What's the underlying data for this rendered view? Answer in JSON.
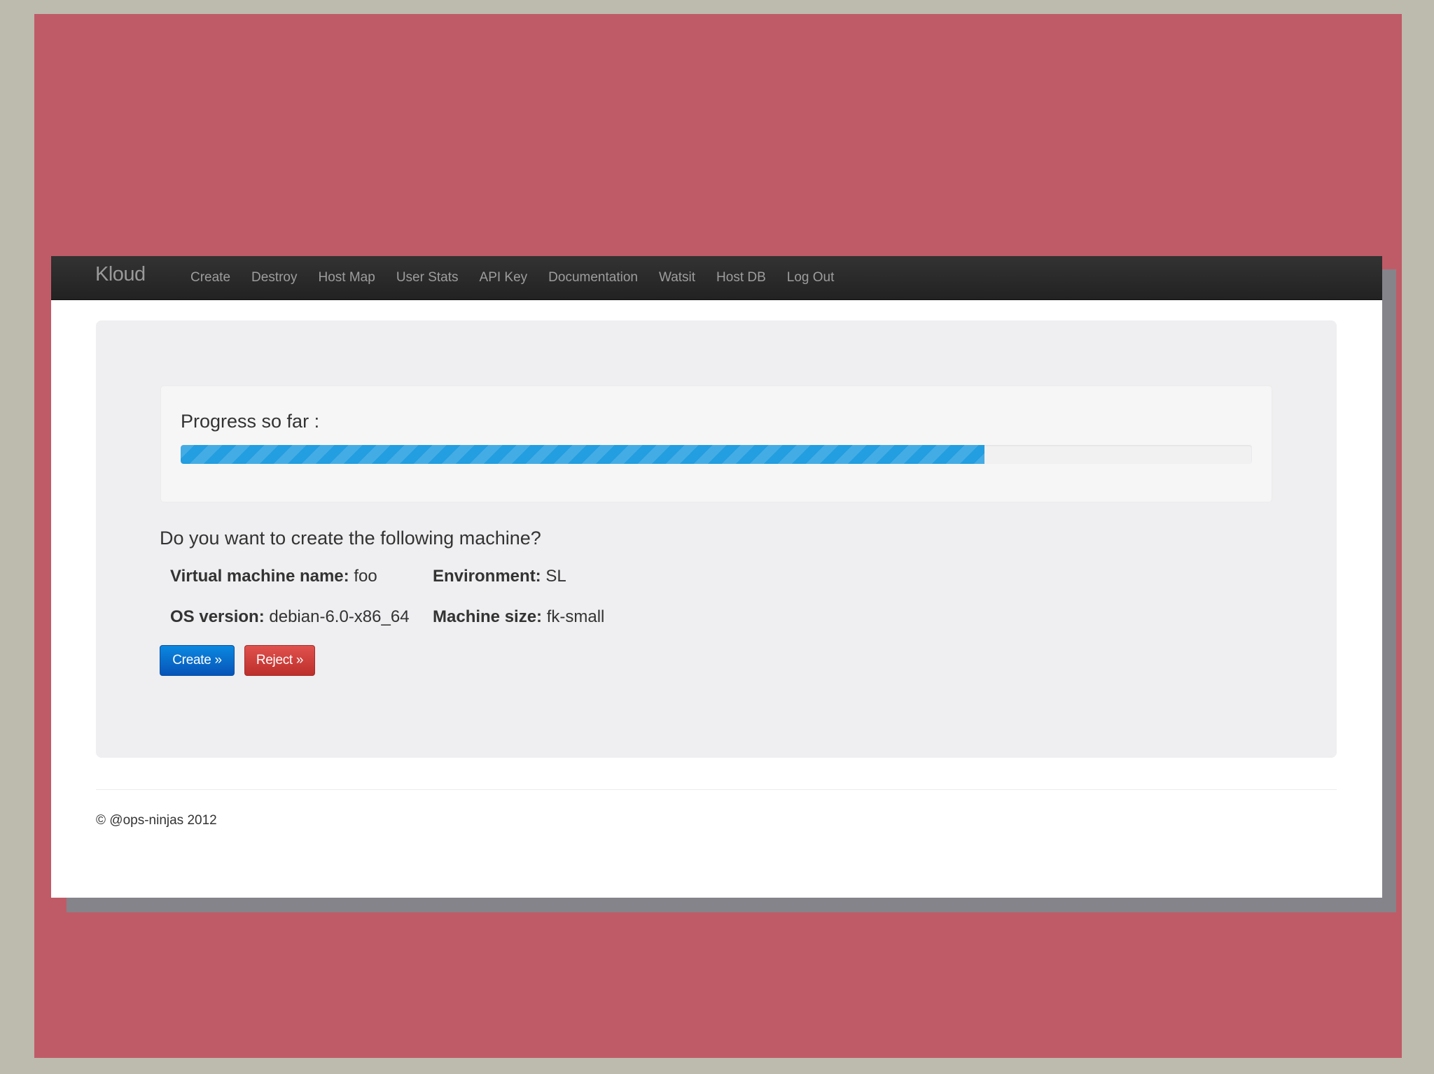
{
  "navbar": {
    "brand": "Kloud",
    "links": [
      "Create",
      "Destroy",
      "Host Map",
      "User Stats",
      "API Key",
      "Documentation",
      "Watsit",
      "Host DB",
      "Log Out"
    ]
  },
  "progress": {
    "label": "Progress so far :",
    "percent": 75
  },
  "confirm": {
    "question": "Do you want to create the following machine?",
    "details": {
      "vm_name_label": "Virtual machine name:",
      "vm_name_value": " foo",
      "environment_label": "Environment:",
      "environment_value": " SL",
      "os_version_label": "OS version:",
      "os_version_value": " debian-6.0-x86_64",
      "machine_size_label": "Machine size:",
      "machine_size_value": " fk-small"
    },
    "create_button": "Create »",
    "reject_button": "Reject »"
  },
  "footer": {
    "copyright": "© @ops-ninjas 2012"
  },
  "colors": {
    "slide_background": "#bf5b67",
    "progress_fill": "#239ee0",
    "primary_button": "#0754b8",
    "danger_button": "#bd2f2b"
  }
}
